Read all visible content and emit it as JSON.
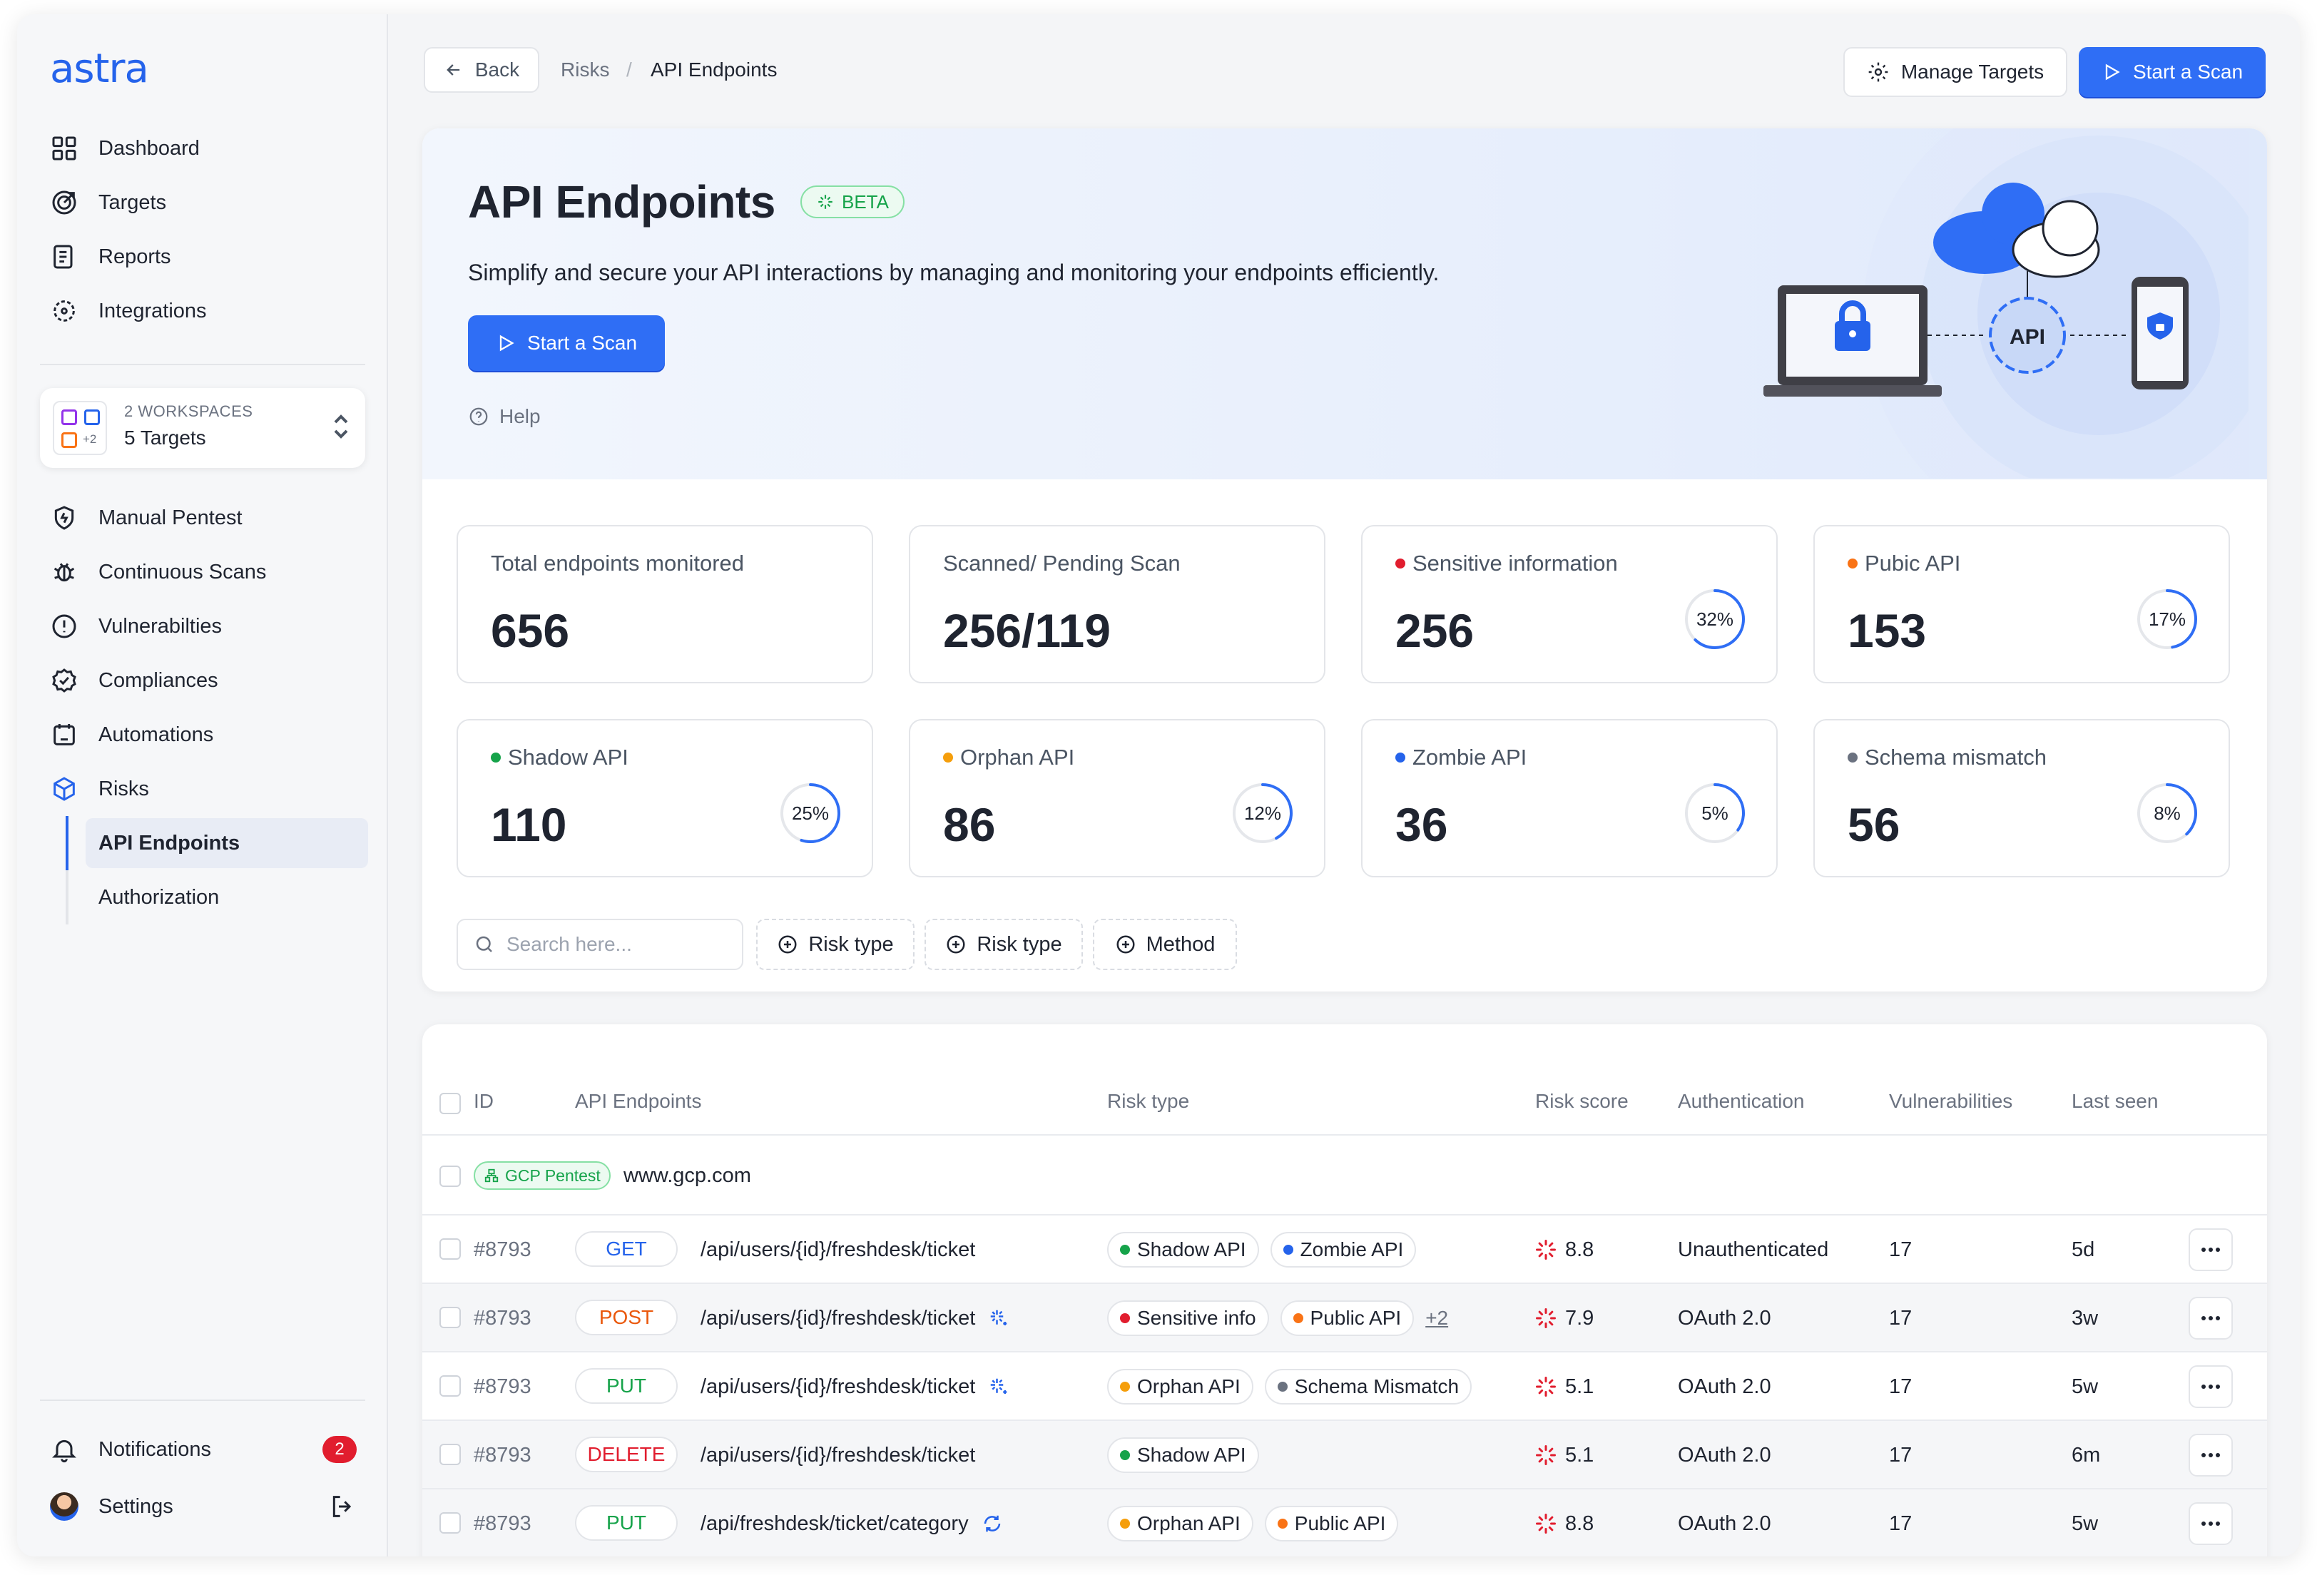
{
  "app": {
    "logo": "astra"
  },
  "sidebar": {
    "nav_top": [
      {
        "label": "Dashboard",
        "icon": "grid-icon"
      },
      {
        "label": "Targets",
        "icon": "target-icon"
      },
      {
        "label": "Reports",
        "icon": "report-icon"
      },
      {
        "label": "Integrations",
        "icon": "integrations-icon"
      }
    ],
    "workspace": {
      "label": "2 WORKSPACES",
      "targets": "5 Targets",
      "more": "+2"
    },
    "nav_main": [
      {
        "label": "Manual Pentest",
        "icon": "shield-icon"
      },
      {
        "label": "Continuous Scans",
        "icon": "bug-icon"
      },
      {
        "label": "Vulnerabilties",
        "icon": "alert-circle-icon"
      },
      {
        "label": "Compliances",
        "icon": "badge-check-icon"
      },
      {
        "label": "Automations",
        "icon": "calendar-bot-icon"
      },
      {
        "label": "Risks",
        "icon": "cube-icon"
      }
    ],
    "sub_items": [
      {
        "label": "API Endpoints",
        "active": true
      },
      {
        "label": "Authorization",
        "active": false
      }
    ],
    "notifications": {
      "label": "Notifications",
      "count": "2"
    },
    "settings": {
      "label": "Settings"
    }
  },
  "topbar": {
    "back": "Back",
    "breadcrumb": [
      "Risks",
      "/",
      "API Endpoints"
    ],
    "manage_targets": "Manage Targets",
    "start_scan": "Start a Scan"
  },
  "hero": {
    "title": "API Endpoints",
    "badge": "BETA",
    "subtitle": "Simplify and secure your API interactions by managing and monitoring your endpoints efficiently.",
    "start_scan": "Start a Scan",
    "help": "Help",
    "illus_label": "API"
  },
  "stats": [
    {
      "label": "Total endpoints monitored",
      "value": "656",
      "dot": null,
      "pct": null
    },
    {
      "label": "Scanned/ Pending Scan",
      "value": "256/119",
      "dot": null,
      "pct": null
    },
    {
      "label": "Sensitive information",
      "value": "256",
      "dot": "#e11d2e",
      "pct": "32%",
      "fraction": 0.32
    },
    {
      "label": "Pubic API",
      "value": "153",
      "dot": "#f97316",
      "pct": "17%",
      "fraction": 0.17
    },
    {
      "label": "Shadow API",
      "value": "110",
      "dot": "#16a34a",
      "pct": "25%",
      "fraction": 0.25
    },
    {
      "label": "Orphan API",
      "value": "86",
      "dot": "#f59e0b",
      "pct": "12%",
      "fraction": 0.12
    },
    {
      "label": "Zombie API",
      "value": "36",
      "dot": "#2563eb",
      "pct": "5%",
      "fraction": 0.05
    },
    {
      "label": "Schema mismatch",
      "value": "56",
      "dot": "#6b7280",
      "pct": "8%",
      "fraction": 0.08
    }
  ],
  "filters": {
    "search_placeholder": "Search here...",
    "chips": [
      "Risk type",
      "Risk type",
      "Method"
    ]
  },
  "table": {
    "headers": [
      "ID",
      "API Endpoints",
      "Risk type",
      "Risk score",
      "Authentication",
      "Vulnerabilities",
      "Last seen"
    ],
    "group": {
      "tag": "GCP Pentest",
      "host": "www.gcp.com"
    },
    "rows": [
      {
        "id": "#8793",
        "method": "GET",
        "method_color": "#2563eb",
        "endpoint": "/api/users/{id}/freshdesk/ticket",
        "icon": null,
        "risks": [
          {
            "label": "Shadow API",
            "color": "#16a34a"
          },
          {
            "label": "Zombie API",
            "color": "#2563eb"
          }
        ],
        "extra": "",
        "score": "8.8",
        "auth": "Unauthenticated",
        "vulns": "17",
        "seen": "5d"
      },
      {
        "id": "#8793",
        "method": "POST",
        "method_color": "#ea580c",
        "endpoint": "/api/users/{id}/freshdesk/ticket",
        "icon": "sparkle-icon",
        "risks": [
          {
            "label": "Sensitive info",
            "color": "#e11d2e"
          },
          {
            "label": "Public API",
            "color": "#f97316"
          }
        ],
        "extra": "+2",
        "score": "7.9",
        "auth": "OAuth 2.0",
        "vulns": "17",
        "seen": "3w"
      },
      {
        "id": "#8793",
        "method": "PUT",
        "method_color": "#16a34a",
        "endpoint": "/api/users/{id}/freshdesk/ticket",
        "icon": "sparkle-icon",
        "risks": [
          {
            "label": "Orphan API",
            "color": "#f59e0b"
          },
          {
            "label": "Schema Mismatch",
            "color": "#6b7280"
          }
        ],
        "extra": "",
        "score": "5.1",
        "auth": "OAuth 2.0",
        "vulns": "17",
        "seen": "5w"
      },
      {
        "id": "#8793",
        "method": "DELETE",
        "method_color": "#e11d2e",
        "endpoint": "/api/users/{id}/freshdesk/ticket",
        "icon": null,
        "risks": [
          {
            "label": "Shadow API",
            "color": "#16a34a"
          }
        ],
        "extra": "",
        "score": "5.1",
        "auth": "OAuth 2.0",
        "vulns": "17",
        "seen": "6m"
      },
      {
        "id": "#8793",
        "method": "PUT",
        "method_color": "#16a34a",
        "endpoint": "/api/freshdesk/ticket/category",
        "icon": "sync-icon",
        "risks": [
          {
            "label": "Orphan API",
            "color": "#f59e0b"
          },
          {
            "label": "Public API",
            "color": "#f97316"
          }
        ],
        "extra": "",
        "score": "8.8",
        "auth": "OAuth 2.0",
        "vulns": "17",
        "seen": "5w"
      }
    ]
  },
  "colors": {
    "accent": "#2f6ef5",
    "success": "#16a34a",
    "danger": "#e11d2e"
  }
}
